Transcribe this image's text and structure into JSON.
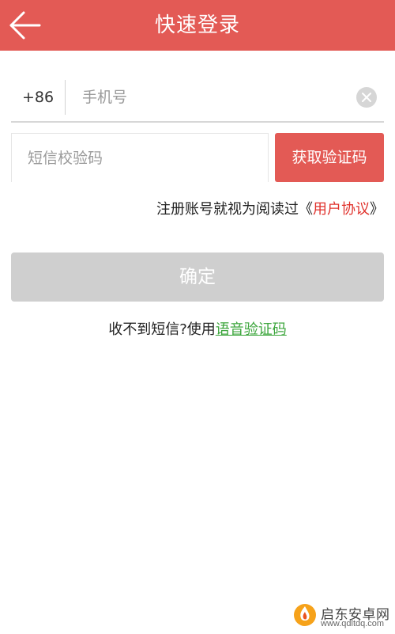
{
  "header": {
    "title": "快速登录"
  },
  "phone": {
    "country_code": "+86",
    "placeholder": "手机号",
    "value": ""
  },
  "sms": {
    "placeholder": "短信校验码",
    "value": "",
    "get_code_label": "获取验证码"
  },
  "agreement": {
    "prefix": "注册账号就视为阅读过《",
    "link": "用户协议",
    "suffix": "》"
  },
  "confirm": {
    "label": "确定"
  },
  "voice": {
    "prefix": "收不到短信?使用",
    "link": "语音验证码"
  },
  "watermark": {
    "text": "启东安卓网",
    "url": "www.qdltdq.com"
  },
  "colors": {
    "brand": "#e35a55",
    "link_red": "#e0322c",
    "link_green": "#3ba53b",
    "disabled_button": "#cfcfcf"
  },
  "icons": {
    "back": "arrow-left-icon",
    "clear": "close-circle-icon",
    "watermark_logo": "flame-logo-icon"
  }
}
